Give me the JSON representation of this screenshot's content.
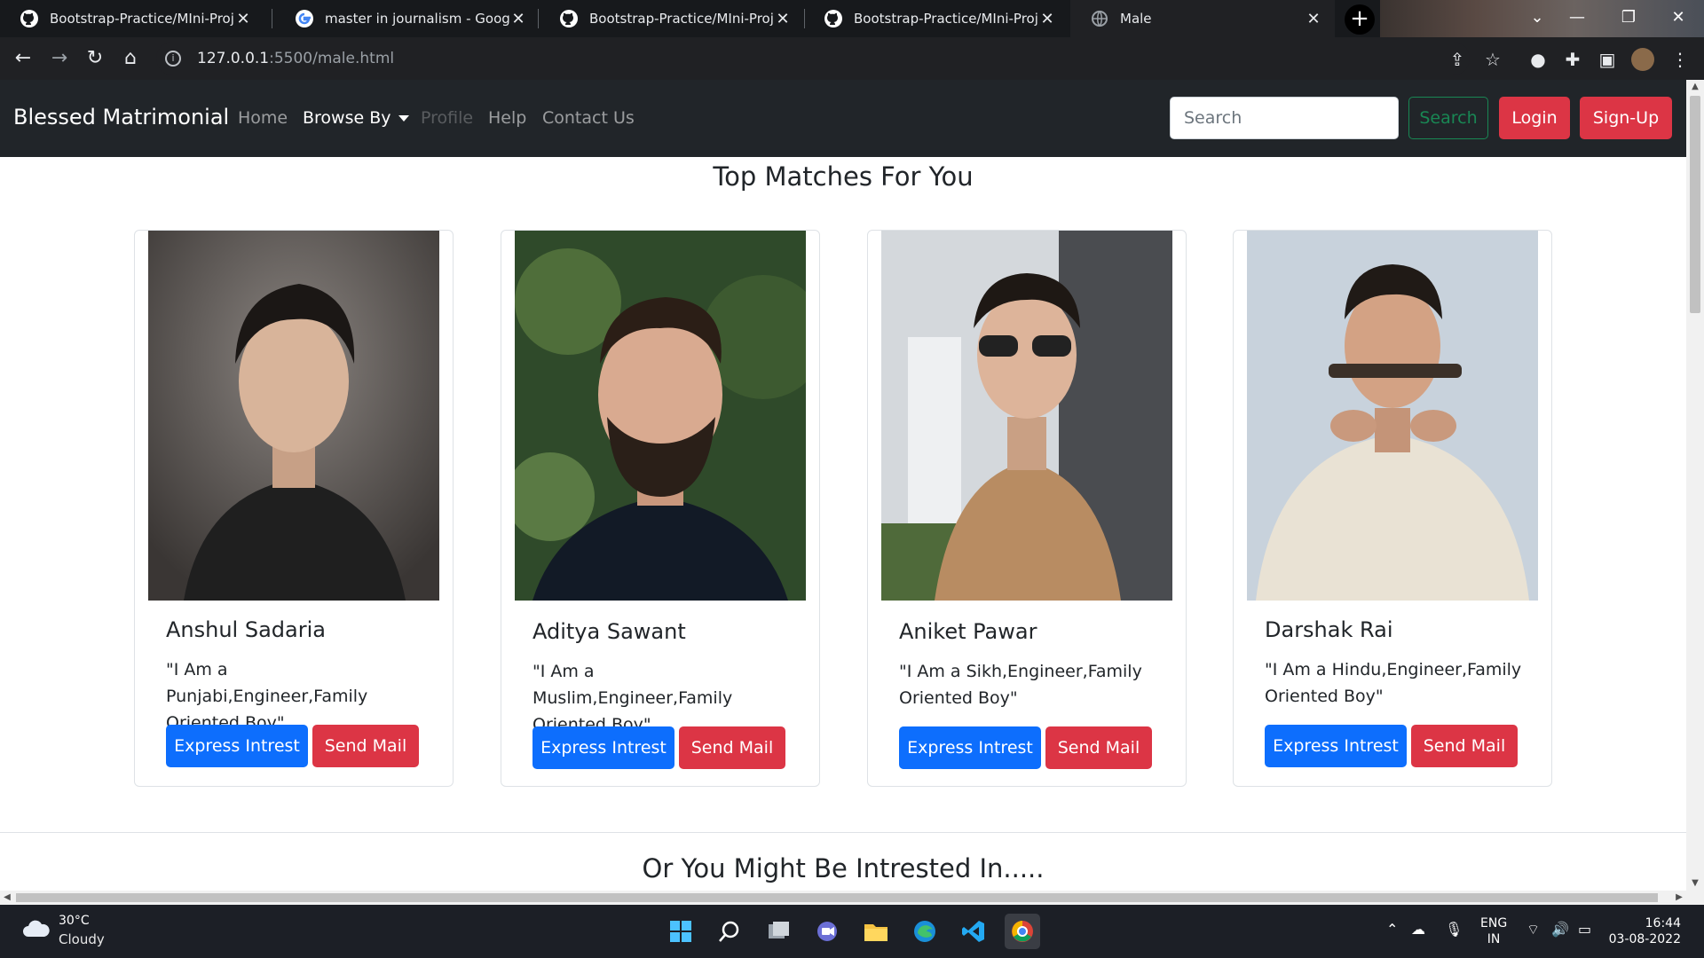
{
  "browser": {
    "tabs": [
      {
        "title": "Bootstrap-Practice/MIni-Project_",
        "icon": "github-icon",
        "active": false
      },
      {
        "title": "master in journalism - Google Se",
        "icon": "google-icon",
        "active": false
      },
      {
        "title": "Bootstrap-Practice/MIni-Project_",
        "icon": "github-icon",
        "active": false
      },
      {
        "title": "Bootstrap-Practice/MIni-Project_",
        "icon": "github-icon",
        "active": false
      },
      {
        "title": "Male",
        "icon": "globe-icon",
        "active": true
      }
    ],
    "url_host": "127.0.0.1",
    "url_rest": ":5500/male.html"
  },
  "navbar": {
    "brand": "Blessed Matrimonial",
    "links": {
      "home": "Home",
      "browse": "Browse By",
      "profile": "Profile",
      "help": "Help",
      "contact": "Contact Us"
    },
    "search_placeholder": "Search",
    "search_button": "Search",
    "login": "Login",
    "signup": "Sign-Up"
  },
  "main": {
    "title": "Top Matches For You",
    "cards": [
      {
        "name": "Anshul Sadaria",
        "desc": "\"I Am a Punjabi,Engineer,Family Oriented Boy\"",
        "btn_interest": "Express Intrest",
        "btn_mail": "Send Mail"
      },
      {
        "name": "Aditya Sawant",
        "desc": "\"I Am a Muslim,Engineer,Family Oriented Boy\"",
        "btn_interest": "Express Intrest",
        "btn_mail": "Send Mail"
      },
      {
        "name": "Aniket Pawar",
        "desc": "\"I Am a Sikh,Engineer,Family Oriented Boy\"",
        "btn_interest": "Express Intrest",
        "btn_mail": "Send Mail"
      },
      {
        "name": "Darshak Rai",
        "desc": "\"I Am a Hindu,Engineer,Family Oriented Boy\"",
        "btn_interest": "Express Intrest",
        "btn_mail": "Send Mail"
      }
    ],
    "subtitle": "Or You Might Be Intrested In....."
  },
  "taskbar": {
    "temp": "30°C",
    "condition": "Cloudy",
    "lang_top": "ENG",
    "lang_bottom": "IN",
    "time": "16:44",
    "date": "03-08-2022"
  },
  "colors": {
    "navbar_bg": "#212529",
    "primary": "#0d6efd",
    "danger": "#dc3545",
    "success": "#198754"
  }
}
